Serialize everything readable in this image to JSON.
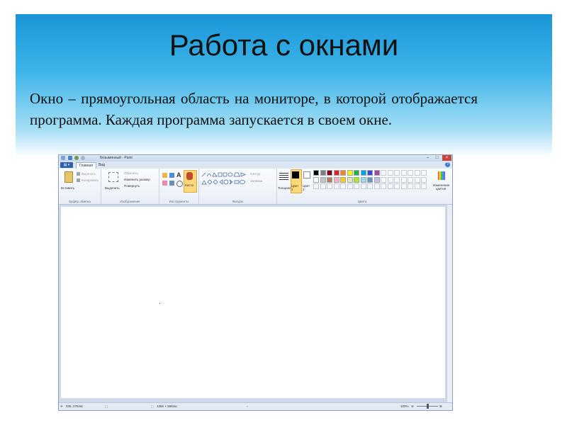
{
  "slide": {
    "title": "Работа с окнами",
    "body": "Окно – прямоугольная область на мониторе, в которой отображается программа. Каждая программа запускается в своем окне."
  },
  "paint": {
    "window_title": "Безымянный - Paint",
    "tabs": [
      "Главная",
      "Вид"
    ],
    "ribbon": {
      "clipboard": {
        "paste": "Вставить",
        "cut": "Вырезать",
        "copy": "Копировать",
        "group": "Буфер обмена"
      },
      "image": {
        "select": "Выделить",
        "crop": "Обрезать",
        "resize": "Изменить размер",
        "rotate": "Повернуть",
        "group": "Изображение"
      },
      "tools": {
        "group": "Инструменты",
        "brushes": "Кисти"
      },
      "shapes": {
        "outline": "Контур",
        "fill": "Заливка",
        "group": "Фигуры"
      },
      "colors": {
        "size": "Толщина",
        "color1": "Цвет 1",
        "color2": "Цвет 2",
        "edit": "Изменение цветов",
        "group": "Цвета"
      }
    },
    "status": {
      "cursor": "335, 276пкс",
      "dimensions": "1366 × 566пкс",
      "zoom": "100%"
    }
  },
  "palette": [
    "#000000",
    "#7f7f7f",
    "#880015",
    "#ed1c24",
    "#ff7f27",
    "#fff200",
    "#22b14c",
    "#00a2e8",
    "#3f48cc",
    "#a349a4",
    "#ffffff",
    "#c3c3c3",
    "#b97a57",
    "#ffaec9",
    "#ffc90e",
    "#efe4b0",
    "#b5e61d",
    "#99d9ea",
    "#7092be",
    "#c8bfe7"
  ]
}
